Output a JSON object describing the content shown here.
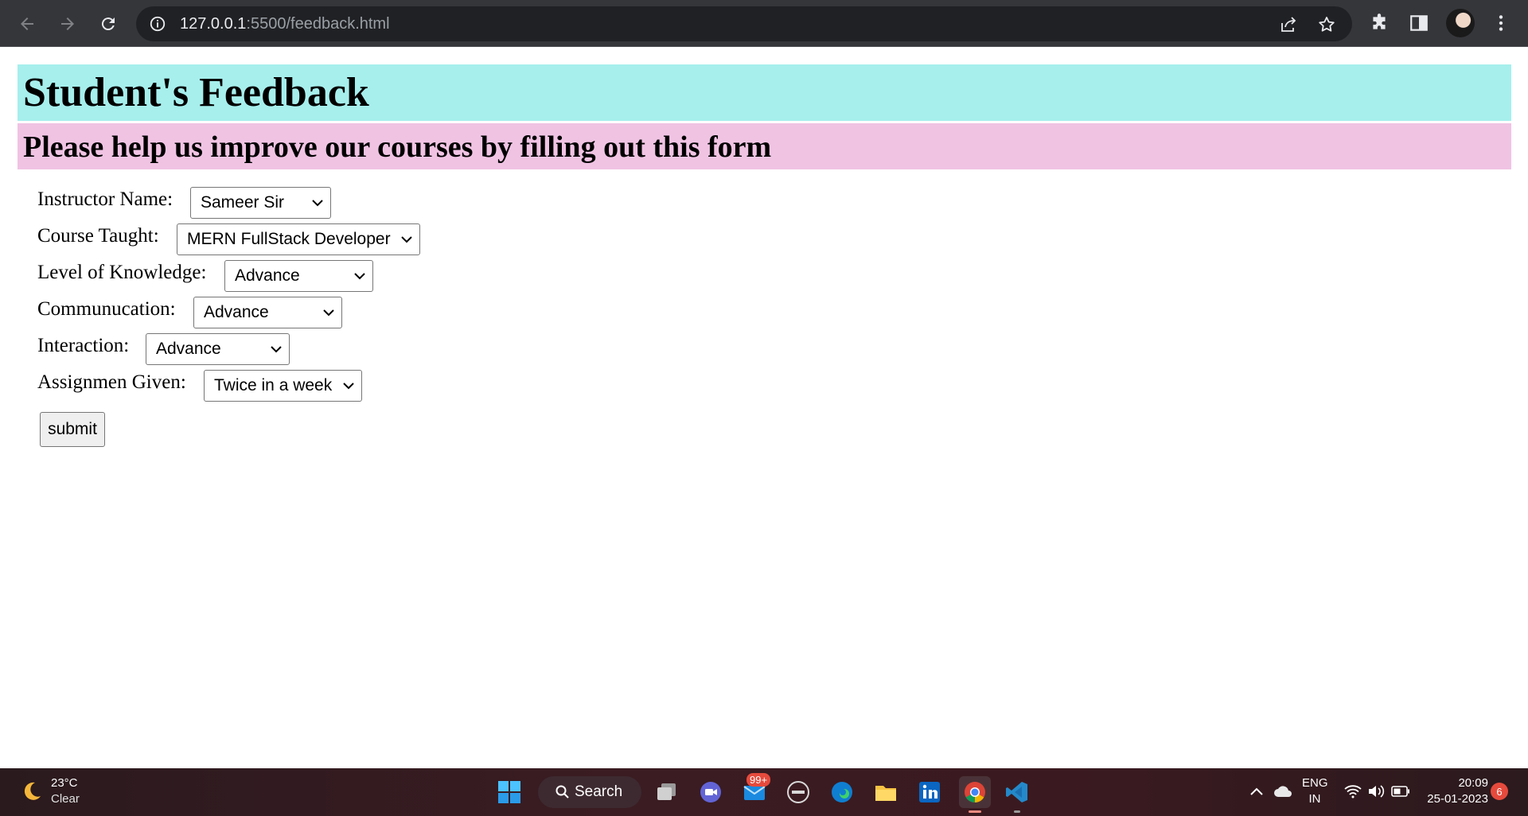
{
  "browser": {
    "url_host": "127.0.0.1",
    "url_path": ":5500/feedback.html"
  },
  "page": {
    "title": "Student's Feedback",
    "subtitle": "Please help us improve our courses by filling out this form",
    "fields": [
      {
        "label": "Instructor Name:",
        "value": "Sameer Sir"
      },
      {
        "label": "Course Taught:",
        "value": "MERN FullStack Developer"
      },
      {
        "label": "Level of Knowledge:",
        "value": "Advance"
      },
      {
        "label": "Communucation:",
        "value": "Advance"
      },
      {
        "label": "Interaction:",
        "value": "Advance"
      },
      {
        "label": "Assignmen Given:",
        "value": "Twice in a week"
      }
    ],
    "submit_label": "submit"
  },
  "taskbar": {
    "weather_temp": "23°C",
    "weather_condition": "Clear",
    "search_label": "Search",
    "mail_badge": "99+",
    "language": "ENG",
    "region": "IN",
    "time": "20:09",
    "date": "25-01-2023",
    "notification_count": "6"
  },
  "colors": {
    "title_bg": "#a6efed",
    "subtitle_bg": "#f0c3e3"
  }
}
